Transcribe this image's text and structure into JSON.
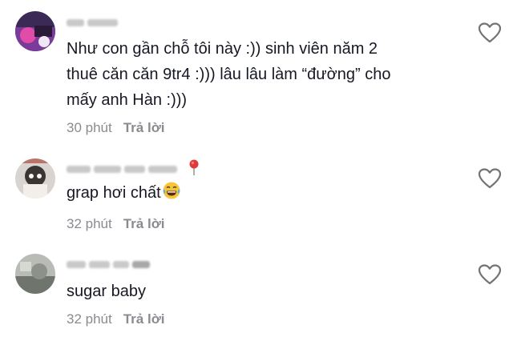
{
  "comments": [
    {
      "text_lines": [
        "Như con gần chỗ tôi này :)) sinh viên năm 2",
        "thuê căn căn 9tr4 :))) lâu lâu làm “đường” cho",
        "mấy anh Hàn :)))"
      ],
      "time": "30 phút",
      "reply_label": "Trả lời",
      "liked": false
    },
    {
      "text_lines": [
        "grap hơi chất"
      ],
      "has_emoji": true,
      "emoji": "laughing-tears",
      "time": "32 phút",
      "reply_label": "Trả lời",
      "liked": false,
      "has_pin_badge": true
    },
    {
      "text_lines": [
        "sugar baby"
      ],
      "time": "32 phút",
      "reply_label": "Trả lời",
      "liked": false
    }
  ],
  "icons": {
    "like": "heart-outline-icon",
    "pin": "location-pin-icon"
  },
  "colors": {
    "text": "#161823",
    "meta": "#8a8b91",
    "icon": "#737373",
    "pin": "#e03a3a"
  }
}
